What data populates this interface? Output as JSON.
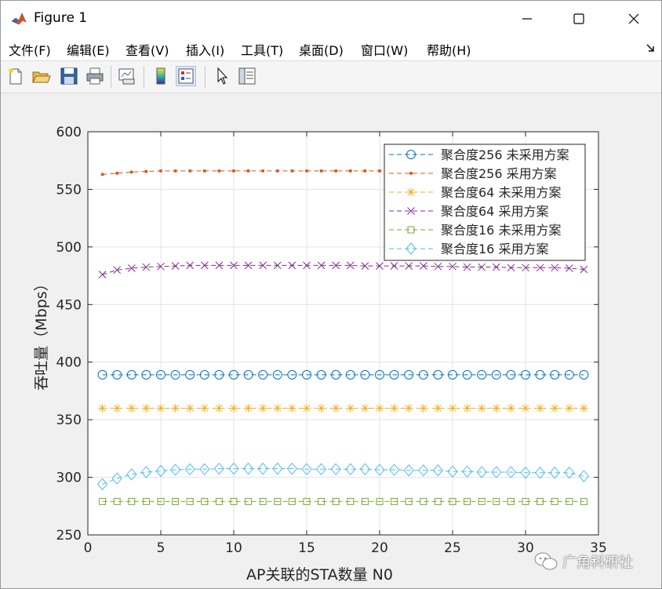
{
  "window": {
    "title": "Figure 1"
  },
  "menu": [
    "文件(F)",
    "编辑(E)",
    "查看(V)",
    "插入(I)",
    "工具(T)",
    "桌面(D)",
    "窗口(W)",
    "帮助(H)"
  ],
  "toolbar": {
    "buttons": [
      "new-figure",
      "open-file",
      "save-figure",
      "print-figure",
      "link-plot",
      "insert-colorbar",
      "insert-legend",
      "edit-plot",
      "property-inspector"
    ],
    "active": "insert-legend"
  },
  "watermark": "广角科研社",
  "chart_data": {
    "type": "line",
    "xlabel": "AP关联的STA数量 N0",
    "ylabel": "吞吐量（Mbps）",
    "xlim": [
      0,
      35
    ],
    "ylim": [
      250,
      600
    ],
    "xticks": [
      "0",
      "5",
      "10",
      "15",
      "20",
      "25",
      "30",
      "35"
    ],
    "yticks": [
      "250",
      "300",
      "350",
      "400",
      "450",
      "500",
      "550",
      "600"
    ],
    "grid": true,
    "legend_position": "top-right",
    "x": [
      1,
      2,
      3,
      4,
      5,
      6,
      7,
      8,
      9,
      10,
      11,
      12,
      13,
      14,
      15,
      16,
      17,
      18,
      19,
      20,
      21,
      22,
      23,
      24,
      25,
      26,
      27,
      28,
      29,
      30,
      31,
      32,
      33,
      34
    ],
    "series": [
      {
        "name": "聚合度256 未采用方案",
        "color": "#0072BD",
        "marker": "circle",
        "values": [
          389,
          389,
          389,
          389,
          389,
          389,
          389,
          389,
          389,
          389,
          389,
          389,
          389,
          389,
          389,
          389,
          389,
          389,
          389,
          389,
          389,
          389,
          389,
          389,
          389,
          389,
          389,
          389,
          389,
          389,
          389,
          389,
          389,
          389
        ]
      },
      {
        "name": "聚合度256 采用方案",
        "color": "#D95319",
        "marker": "point",
        "values": [
          563,
          564,
          565,
          565.5,
          566,
          566,
          566,
          566,
          566,
          566,
          566,
          566,
          566,
          566,
          566,
          566,
          566,
          566,
          566,
          566,
          566,
          566,
          566,
          566,
          566,
          566,
          566,
          566,
          566,
          566,
          566,
          566,
          566,
          566
        ]
      },
      {
        "name": "聚合度64 未采用方案",
        "color": "#EDB120",
        "marker": "star",
        "values": [
          360,
          360,
          360,
          360,
          360,
          360,
          360,
          360,
          360,
          360,
          360,
          360,
          360,
          360,
          360,
          360,
          360,
          360,
          360,
          360,
          360,
          360,
          360,
          360,
          360,
          360,
          360,
          360,
          360,
          360,
          360,
          360,
          360,
          360
        ]
      },
      {
        "name": "聚合度64 采用方案",
        "color": "#7E2F8E",
        "marker": "x",
        "values": [
          476,
          480,
          481.5,
          482.5,
          483,
          483.5,
          484,
          484,
          484,
          484,
          484,
          484,
          484,
          484,
          484,
          484,
          484,
          484,
          483.5,
          483.5,
          483.5,
          483.5,
          483.5,
          483,
          483,
          482.5,
          482.5,
          482.5,
          482,
          482,
          482,
          482,
          481.5,
          480.5
        ]
      },
      {
        "name": "聚合度16 未采用方案",
        "color": "#77AC30",
        "marker": "square",
        "values": [
          279,
          279,
          279,
          279,
          279,
          279,
          279,
          279,
          279,
          279,
          279,
          279,
          279,
          279,
          279,
          279,
          279,
          279,
          279,
          279,
          279,
          279,
          279,
          279,
          279,
          279,
          279,
          279,
          279,
          279,
          279,
          279,
          279,
          279
        ]
      },
      {
        "name": "聚合度16 采用方案",
        "color": "#4DBEEE",
        "marker": "diamond",
        "values": [
          294,
          299,
          302.5,
          304.5,
          305.5,
          306.5,
          307,
          307,
          307.5,
          307.5,
          307.5,
          307.5,
          307.5,
          307.5,
          307,
          307,
          307,
          307,
          307,
          306.5,
          306.5,
          306,
          306,
          306,
          305,
          305,
          304.5,
          304.5,
          304.5,
          304,
          304,
          304,
          304,
          301
        ]
      }
    ]
  }
}
